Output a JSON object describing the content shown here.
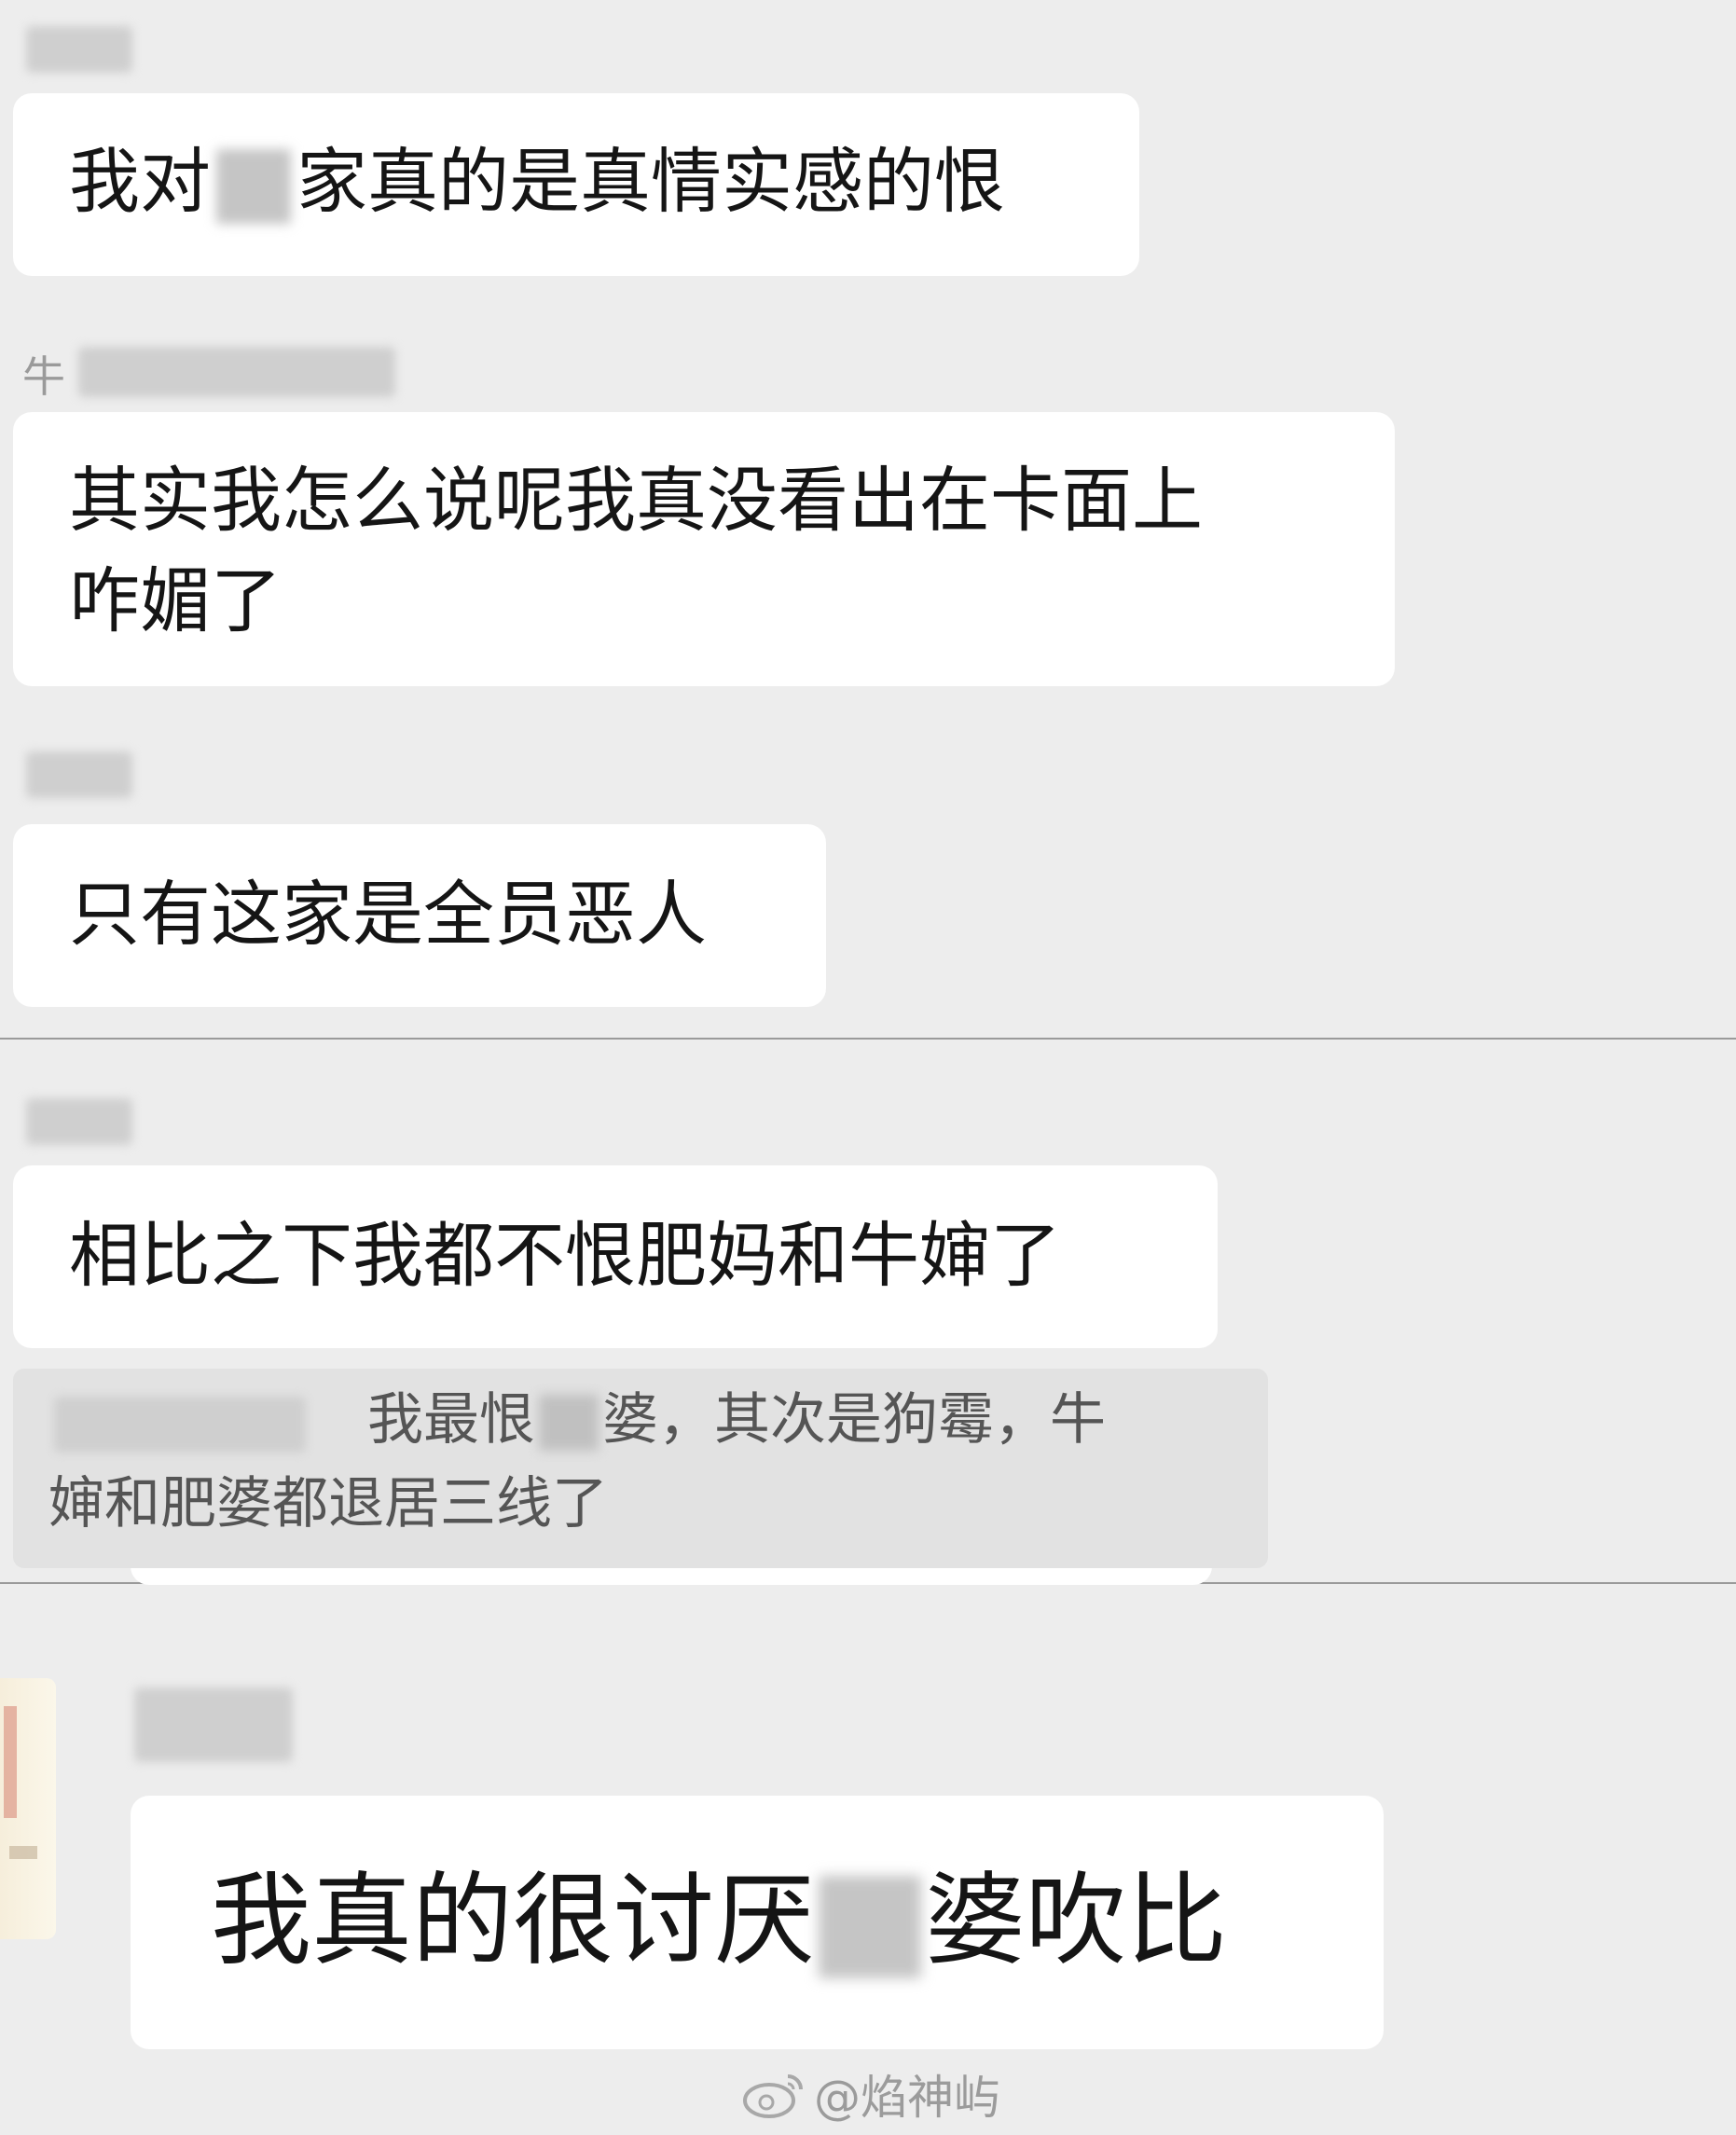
{
  "messages": [
    {
      "sender_prefix": "",
      "text_before": "我对",
      "text_after": "家真的是真情实感的恨"
    },
    {
      "sender_prefix": "牛",
      "line1": "其实我怎么说呢我真没看出在卡面上",
      "line2": "咋媚了"
    },
    {
      "sender_prefix": "",
      "text": "只有这家是全员恶人"
    },
    {
      "sender_prefix": "",
      "text": "相比之下我都不恨肥妈和牛婶了"
    },
    {
      "quote_line1_a": "我最恨",
      "quote_line1_b": "婆，其次是狗霉，牛",
      "quote_line2": "婶和肥婆都退居三线了"
    },
    {
      "sender_prefix": "",
      "text_before": "我真的很讨厌",
      "text_after": "婆吹比"
    }
  ],
  "watermark": {
    "platform_icon": "weibo-icon",
    "handle": "@焰神屿"
  },
  "colors": {
    "background": "#ededed",
    "bubble": "#ffffff",
    "quote": "#e2e2e2",
    "sender_text": "#9a9a9a"
  }
}
